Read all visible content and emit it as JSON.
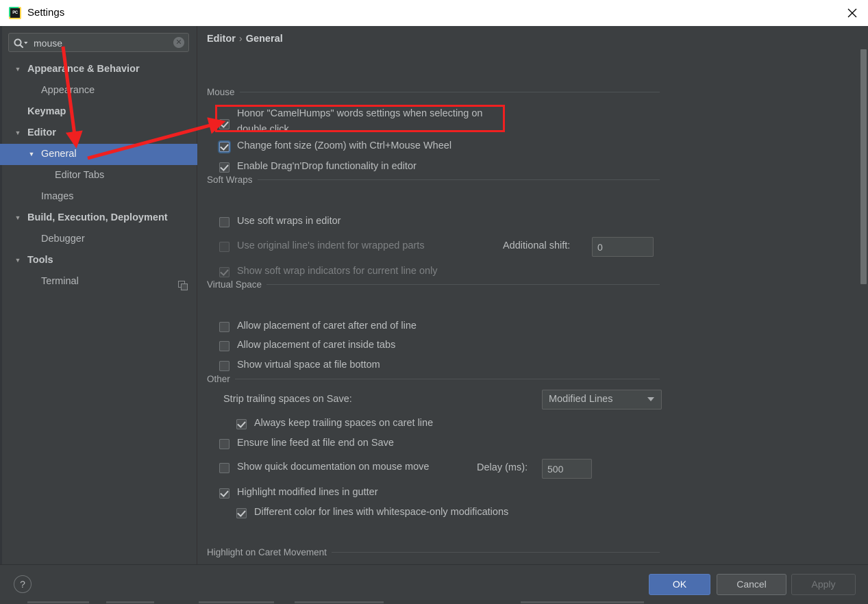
{
  "window": {
    "title": "Settings",
    "app_icon": "pycharm-icon",
    "close_icon": "close-icon"
  },
  "search": {
    "value": "mouse",
    "placeholder": "",
    "icon": "search-icon",
    "clear_icon": "clear-icon",
    "clear_glyph": "✕"
  },
  "sidebar": {
    "items": [
      {
        "label": "Appearance & Behavior",
        "arrow": "▼",
        "indent": 20,
        "text_indent": 40,
        "bold": true,
        "selected": false,
        "name": "sidebar-item-appearance-behavior"
      },
      {
        "label": "Appearance",
        "arrow": "",
        "indent": 0,
        "text_indent": 60,
        "bold": false,
        "selected": false,
        "name": "sidebar-item-appearance"
      },
      {
        "label": "Keymap",
        "arrow": "",
        "indent": 0,
        "text_indent": 40,
        "bold": true,
        "selected": false,
        "name": "sidebar-item-keymap"
      },
      {
        "label": "Editor",
        "arrow": "▼",
        "indent": 20,
        "text_indent": 40,
        "bold": true,
        "selected": false,
        "name": "sidebar-item-editor"
      },
      {
        "label": "General",
        "arrow": "▼",
        "indent": 40,
        "text_indent": 60,
        "bold": false,
        "selected": true,
        "name": "sidebar-item-general"
      },
      {
        "label": "Editor Tabs",
        "arrow": "",
        "indent": 0,
        "text_indent": 80,
        "bold": false,
        "selected": false,
        "name": "sidebar-item-editor-tabs"
      },
      {
        "label": "Images",
        "arrow": "",
        "indent": 0,
        "text_indent": 60,
        "bold": false,
        "selected": false,
        "name": "sidebar-item-images"
      },
      {
        "label": "Build, Execution, Deployment",
        "arrow": "▼",
        "indent": 20,
        "text_indent": 40,
        "bold": true,
        "selected": false,
        "name": "sidebar-item-build-execution-deployment"
      },
      {
        "label": "Debugger",
        "arrow": "",
        "indent": 0,
        "text_indent": 60,
        "bold": false,
        "selected": false,
        "name": "sidebar-item-debugger"
      },
      {
        "label": "Tools",
        "arrow": "▼",
        "indent": 20,
        "text_indent": 40,
        "bold": true,
        "selected": false,
        "name": "sidebar-item-tools"
      },
      {
        "label": "Terminal",
        "arrow": "",
        "indent": 0,
        "text_indent": 60,
        "bold": false,
        "selected": false,
        "name": "sidebar-item-terminal",
        "trailing_icon": "copy-icon"
      }
    ]
  },
  "breadcrumb": {
    "root": "Editor",
    "separator": "›",
    "current": "General"
  },
  "sections": {
    "mouse": {
      "title": "Mouse",
      "options": [
        {
          "label": "Honor \"CamelHumps\" words settings when selecting on",
          "label2": "double click",
          "checked": true,
          "enabled": true,
          "focused": false,
          "name": "checkbox-honor-camelhumps"
        },
        {
          "label": "Change font size (Zoom) with Ctrl+Mouse Wheel",
          "checked": true,
          "enabled": true,
          "focused": true,
          "name": "checkbox-change-font-size-zoom"
        },
        {
          "label": "Enable Drag'n'Drop functionality in editor",
          "checked": true,
          "enabled": true,
          "focused": false,
          "name": "checkbox-enable-drag-n-drop"
        }
      ]
    },
    "soft_wraps": {
      "title": "Soft Wraps",
      "options": [
        {
          "label": "Use soft wraps in editor",
          "checked": false,
          "enabled": true,
          "name": "checkbox-use-soft-wraps"
        },
        {
          "label": "Use original line's indent for wrapped parts",
          "checked": false,
          "enabled": false,
          "name": "checkbox-use-original-indent"
        },
        {
          "label": "Show soft wrap indicators for current line only",
          "checked": true,
          "enabled": false,
          "name": "checkbox-show-soft-wrap-indicators"
        }
      ],
      "additional_shift_label": "Additional shift:",
      "additional_shift_value": "0"
    },
    "virtual_space": {
      "title": "Virtual Space",
      "options": [
        {
          "label": "Allow placement of caret after end of line",
          "checked": false,
          "enabled": true,
          "name": "checkbox-caret-after-end-of-line"
        },
        {
          "label": "Allow placement of caret inside tabs",
          "checked": false,
          "enabled": true,
          "name": "checkbox-caret-inside-tabs"
        },
        {
          "label": "Show virtual space at file bottom",
          "checked": false,
          "enabled": true,
          "name": "checkbox-virtual-space-file-bottom"
        }
      ]
    },
    "other": {
      "title": "Other",
      "strip_trailing_label": "Strip trailing spaces on Save:",
      "strip_trailing_value": "Modified Lines",
      "options": [
        {
          "label": "Always keep trailing spaces on caret line",
          "checked": true,
          "enabled": true,
          "name": "checkbox-always-keep-trailing-spaces"
        },
        {
          "label": "Ensure line feed at file end on Save",
          "checked": false,
          "enabled": true,
          "name": "checkbox-ensure-line-feed"
        },
        {
          "label": "Show quick documentation on mouse move",
          "checked": false,
          "enabled": true,
          "name": "checkbox-show-quick-documentation"
        },
        {
          "label": "Highlight modified lines in gutter",
          "checked": true,
          "enabled": true,
          "name": "checkbox-highlight-modified-lines"
        },
        {
          "label": "Different color for lines with whitespace-only modifications",
          "checked": true,
          "enabled": true,
          "name": "checkbox-different-color-whitespace"
        }
      ],
      "delay_label": "Delay (ms):",
      "delay_value": "500"
    },
    "highlight_caret": {
      "title": "Highlight on Caret Movement"
    }
  },
  "footer": {
    "help_glyph": "?",
    "ok_label": "OK",
    "cancel_label": "Cancel",
    "apply_label": "Apply"
  },
  "annotation": {
    "color": "#f02020",
    "rect_target": "checkbox-change-font-size-zoom",
    "arrows": 2
  },
  "colors": {
    "background": "#3c3f41",
    "selection": "#4b6eaf",
    "titlebar": "#ffffff",
    "accent": "#4b6eaf",
    "annotation_red": "#f02020"
  }
}
